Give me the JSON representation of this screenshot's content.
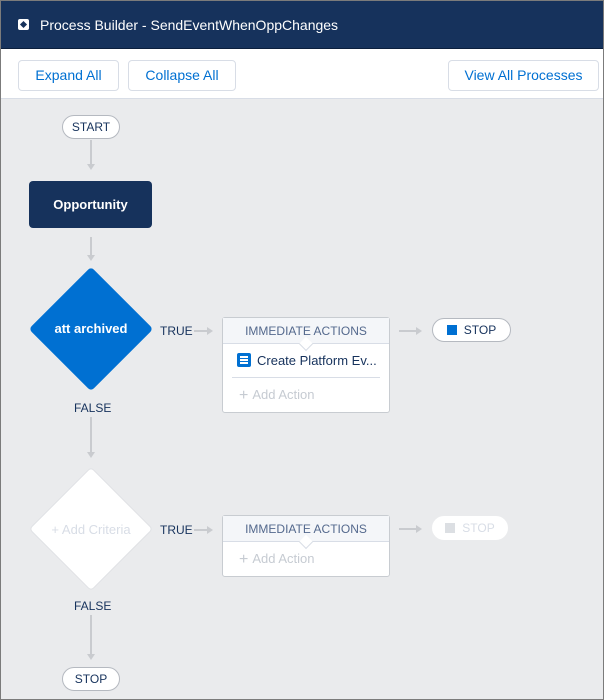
{
  "header": {
    "icon": "process-builder-icon",
    "title": "Process Builder - SendEventWhenOppChanges"
  },
  "toolbar": {
    "expand_all": "Expand All",
    "collapse_all": "Collapse All",
    "view_all_processes": "View All Processes"
  },
  "flow": {
    "start_label": "START",
    "object_node": "Opportunity",
    "criteria": [
      {
        "label": "att archived",
        "state": "active",
        "true_label": "TRUE",
        "false_label": "FALSE",
        "actions_header": "IMMEDIATE ACTIONS",
        "actions": [
          {
            "icon": "list-icon",
            "label": "Create Platform Ev..."
          }
        ],
        "add_action_label": "Add Action",
        "stop_label": "STOP",
        "stop_active": true
      },
      {
        "label": "Add Criteria",
        "state": "empty",
        "true_label": "TRUE",
        "false_label": "FALSE",
        "actions_header": "IMMEDIATE ACTIONS",
        "actions": [],
        "add_action_label": "Add Action",
        "stop_label": "STOP",
        "stop_active": false
      }
    ],
    "end_stop_label": "STOP",
    "plus_glyph": "+"
  },
  "colors": {
    "header_bg": "#16325c",
    "brand_blue": "#0070d2",
    "canvas_bg": "#eaebed"
  }
}
